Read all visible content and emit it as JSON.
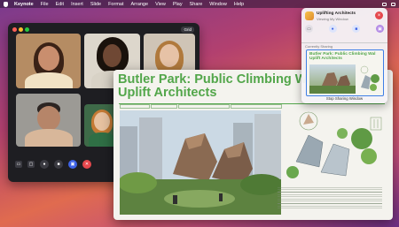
{
  "menubar": {
    "app": "Keynote",
    "items": [
      "File",
      "Edit",
      "Insert",
      "Slide",
      "Format",
      "Arrange",
      "View",
      "Play",
      "Share",
      "Window",
      "Help"
    ]
  },
  "facetime": {
    "grid_label": "Grid",
    "participants": [
      {
        "skin": "#c98e6e",
        "hair": "#3a2216",
        "shirt": "#f1e2c4",
        "bg": "#b58c63"
      },
      {
        "skin": "#6f4834",
        "hair": "#1a120c",
        "shirt": "#d8d2c6",
        "bg": "#ddd7cc"
      },
      {
        "skin": "#e6c2a6",
        "hair": "#b0793c",
        "shirt": "#3a5c8a",
        "bg": "#cfc4b6"
      },
      {
        "skin": "#b68569",
        "hair": "#2d2522",
        "shirt": "#d8b79a",
        "bg": "#9c9a95"
      },
      {
        "skin": "#e7c2a0",
        "hair": "#c47a34",
        "shirt": "#2f6f45",
        "bg": "#3e6a48"
      }
    ]
  },
  "keynote": {
    "title_line1": "Butler Park: Public Climbing Wal",
    "title_line2": "Uplift Architects",
    "colors": {
      "accent": "#52a64a"
    }
  },
  "popover": {
    "title": "Uplifting Architects",
    "subtitle": "Viewing My Window",
    "currently_sharing": "Currently Sharing",
    "thumb_title": "Butler Park: Public Climbing Wal",
    "thumb_subtitle": "Uplift Architects",
    "stop_label": "Stop Sharing Window",
    "icons": [
      "message-icon",
      "microphone-icon",
      "video-icon",
      "screen-share-icon"
    ]
  }
}
